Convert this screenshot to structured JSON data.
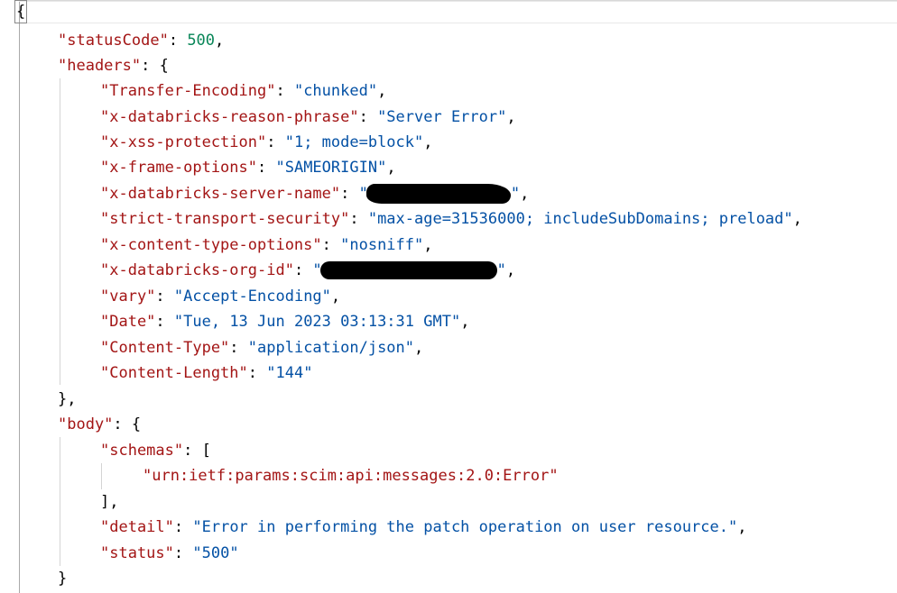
{
  "json": {
    "open_brace": "{",
    "close_brace": "}",
    "status_code": {
      "key": "\"statusCode\"",
      "value": "500"
    },
    "headers": {
      "key": "\"headers\"",
      "open": "{",
      "close": "},",
      "items": [
        {
          "key": "\"Transfer-Encoding\"",
          "value": "\"chunked\""
        },
        {
          "key": "\"x-databricks-reason-phrase\"",
          "value": "\"Server Error\""
        },
        {
          "key": "\"x-xss-protection\"",
          "value": "\"1; mode=block\""
        },
        {
          "key": "\"x-frame-options\"",
          "value": "\"SAMEORIGIN\""
        },
        {
          "key": "\"x-databricks-server-name\"",
          "value": "\"",
          "value_end": "\"",
          "redacted": true
        },
        {
          "key": "\"strict-transport-security\"",
          "value": "\"max-age=31536000; includeSubDomains; preload\""
        },
        {
          "key": "\"x-content-type-options\"",
          "value": "\"nosniff\""
        },
        {
          "key": "\"x-databricks-org-id\"",
          "value": "\"",
          "value_end": "\"",
          "redacted": true
        },
        {
          "key": "\"vary\"",
          "value": "\"Accept-Encoding\""
        },
        {
          "key": "\"Date\"",
          "value": "\"Tue, 13 Jun 2023 03:13:31 GMT\""
        },
        {
          "key": "\"Content-Type\"",
          "value": "\"application/json\""
        },
        {
          "key": "\"Content-Length\"",
          "value": "\"144\""
        }
      ]
    },
    "body": {
      "key": "\"body\"",
      "open": "{",
      "close": "}",
      "schemas_key": "\"schemas\"",
      "schemas_open": "[",
      "schemas_close": "],",
      "schema_item": "\"urn:ietf:params:scim:api:messages:2.0:Error\"",
      "detail": {
        "key": "\"detail\"",
        "value": "\"Error in performing the patch operation on user resource.\""
      },
      "status": {
        "key": "\"status\"",
        "value": "\"500\""
      }
    }
  },
  "colors": {
    "key": "#a31515",
    "string": "#0451a5",
    "number": "#098658",
    "punctuation": "#000000"
  }
}
